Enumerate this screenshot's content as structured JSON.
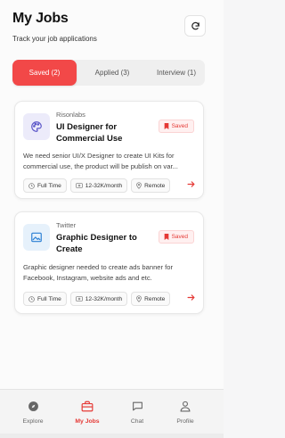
{
  "header": {
    "title": "My Jobs",
    "subtitle": "Track your job applications"
  },
  "tabs": [
    {
      "label": "Saved (2)",
      "active": true
    },
    {
      "label": "Applied (3)",
      "active": false
    },
    {
      "label": "Interview (1)",
      "active": false
    }
  ],
  "jobs": [
    {
      "company": "Risonlabs",
      "title": "UI Designer for Commercial Use",
      "badge": "Saved",
      "description": "We need senior UI/X Designer to create UI Kits for commercial use, the product will be publish on var...",
      "type": "Full Time",
      "salary": "12-32K/month",
      "location": "Remote",
      "logo_icon": "palette-icon"
    },
    {
      "company": "Twitter",
      "title": "Graphic Designer to Create",
      "badge": "Saved",
      "description": "Graphic designer needed to create ads banner for Facebook, Instagram, website ads and etc.",
      "type": "Full Time",
      "salary": "12-32K/month",
      "location": "Remote",
      "logo_icon": "image-icon"
    }
  ],
  "nav": [
    {
      "label": "Explore",
      "icon": "compass-icon",
      "active": false
    },
    {
      "label": "My Jobs",
      "icon": "briefcase-icon",
      "active": true
    },
    {
      "label": "Chat",
      "icon": "chat-icon",
      "active": false
    },
    {
      "label": "Profile",
      "icon": "user-icon",
      "active": false
    }
  ],
  "colors": {
    "accent": "#f24848",
    "background": "#fbfbfb"
  }
}
